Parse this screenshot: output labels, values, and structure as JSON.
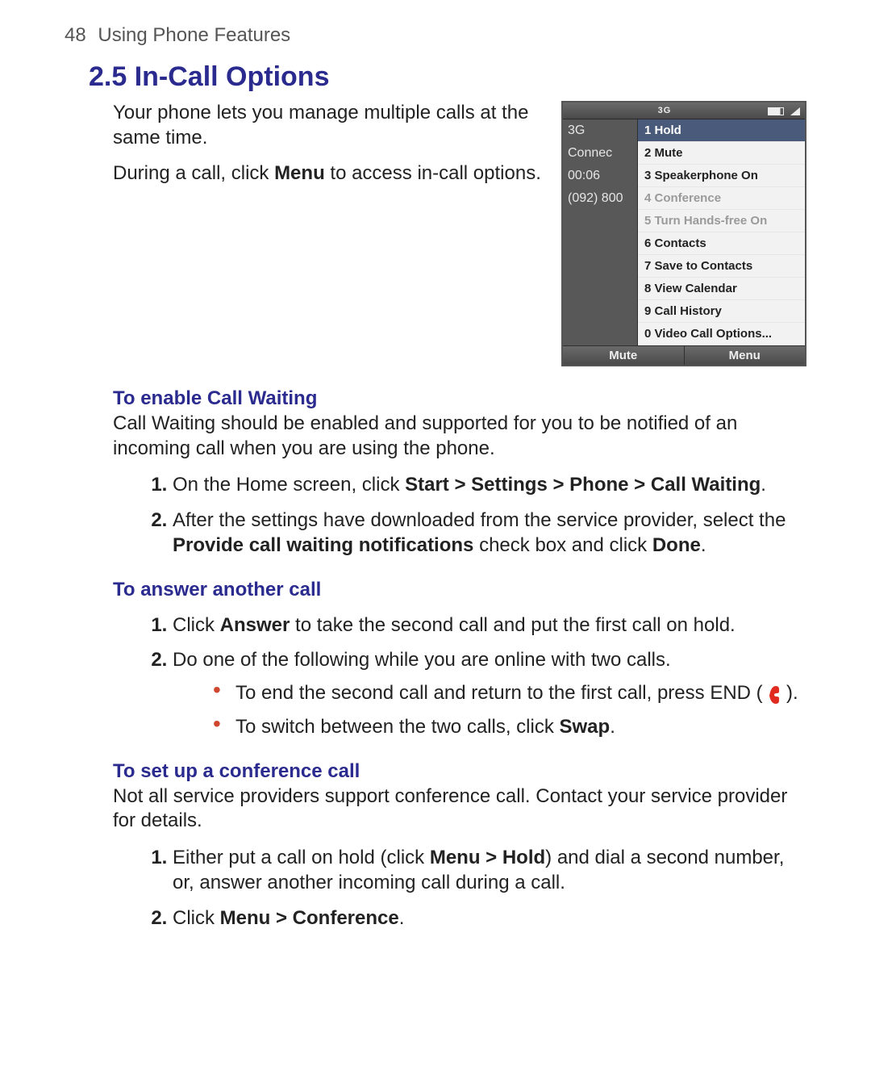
{
  "header": {
    "page_number": "48",
    "chapter": "Using Phone Features"
  },
  "section": {
    "number": "2.5",
    "title": "In-Call Options"
  },
  "intro": {
    "p1": "Your phone lets you manage multiple calls at the same time.",
    "p2_before": "During a call, click ",
    "p2_bold": "Menu",
    "p2_after": " to access in-call options."
  },
  "phone": {
    "status_label": "3G",
    "left": {
      "nw": "3G",
      "status": "Connec",
      "time": "00:06",
      "number": "(092) 800"
    },
    "menu": [
      {
        "label": "1 Hold",
        "disabled": false
      },
      {
        "label": "2 Mute",
        "disabled": false
      },
      {
        "label": "3 Speakerphone On",
        "disabled": false
      },
      {
        "label": "4 Conference",
        "disabled": true
      },
      {
        "label": "5 Turn Hands-free On",
        "disabled": true
      },
      {
        "label": "6 Contacts",
        "disabled": false
      },
      {
        "label": "7 Save to Contacts",
        "disabled": false
      },
      {
        "label": "8 View Calendar",
        "disabled": false
      },
      {
        "label": "9 Call History",
        "disabled": false
      },
      {
        "label": "0 Video Call Options...",
        "disabled": false
      }
    ],
    "softkeys": {
      "left": "Mute",
      "right": "Menu"
    }
  },
  "callwaiting": {
    "title": "To enable Call Waiting",
    "body": "Call Waiting should be enabled and supported for you to be notified of an incoming call when you are using the phone.",
    "step1_before": "On the Home screen, click ",
    "step1_bold": "Start > Settings > Phone > Call Waiting",
    "step1_after": ".",
    "step2_before": "After the settings have downloaded from the service provider, select the ",
    "step2_bold1": "Provide call waiting notifications",
    "step2_mid": " check box and click ",
    "step2_bold2": "Done",
    "step2_after": "."
  },
  "answer": {
    "title": "To answer another call",
    "step1_before": "Click ",
    "step1_bold": "Answer",
    "step1_after": " to take the second call and put the first call on hold.",
    "step2": "Do one of the following while you are online with two calls.",
    "bullet1_before": "To end the second call and return to the first call, press END ( ",
    "bullet1_after": " ).",
    "bullet2_before": "To switch between the two calls, click ",
    "bullet2_bold": "Swap",
    "bullet2_after": "."
  },
  "conference": {
    "title": "To set up a conference call",
    "body": "Not all service providers support conference call. Contact your service provider for details.",
    "step1_before": "Either put a call on hold (click ",
    "step1_bold": "Menu > Hold",
    "step1_after": ") and dial a second number, or, answer another incoming call during a call.",
    "step2_before": "Click ",
    "step2_bold": "Menu > Conference",
    "step2_after": "."
  }
}
